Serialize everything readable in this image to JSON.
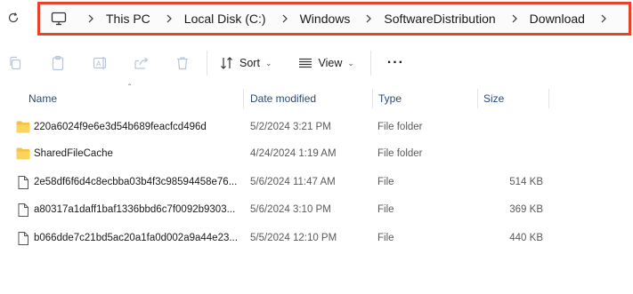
{
  "breadcrumb": [
    "This PC",
    "Local Disk (C:)",
    "Windows",
    "SoftwareDistribution",
    "Download"
  ],
  "toolbar": {
    "sort_label": "Sort",
    "view_label": "View",
    "more_label": "···"
  },
  "columns": {
    "name": "Name",
    "date": "Date modified",
    "type": "Type",
    "size": "Size"
  },
  "files": [
    {
      "name": "220a6024f9e6e3d54b689feacfcd496d",
      "date": "5/2/2024 3:21 PM",
      "type": "File folder",
      "size": "",
      "icon": "folder-icon"
    },
    {
      "name": "SharedFileCache",
      "date": "4/24/2024 1:19 AM",
      "type": "File folder",
      "size": "",
      "icon": "folder-icon"
    },
    {
      "name": "2e58df6f6d4c8ecbba03b4f3c98594458e76...",
      "date": "5/6/2024 11:47 AM",
      "type": "File",
      "size": "514 KB",
      "icon": "file-icon"
    },
    {
      "name": "a80317a1daff1baf1336bbd6c7f0092b9303...",
      "date": "5/6/2024 3:10 PM",
      "type": "File",
      "size": "369 KB",
      "icon": "file-icon"
    },
    {
      "name": "b066dde7c21bd5ac20a1fa0d002a9a44e23...",
      "date": "5/5/2024 12:10 PM",
      "type": "File",
      "size": "440 KB",
      "icon": "file-icon"
    }
  ],
  "colors": {
    "highlight_border": "#e8412c",
    "folder": "#f5c242",
    "header_text": "#2b4a7a"
  }
}
